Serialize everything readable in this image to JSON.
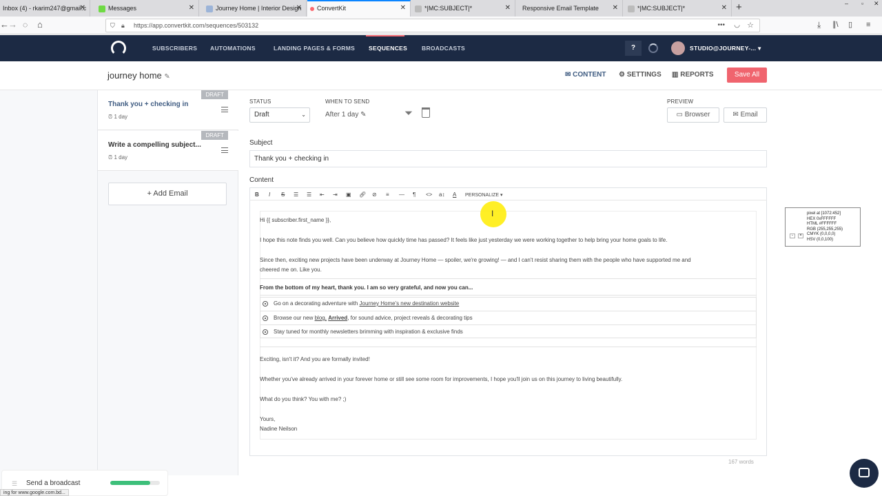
{
  "browser": {
    "tabs": [
      {
        "label": "Inbox (4) - rkarim247@gmail.c",
        "icon": "gmail-icon"
      },
      {
        "label": "Messages",
        "icon": "upwork-icon"
      },
      {
        "label": "Journey Home | Interior Design",
        "icon": "page-icon"
      },
      {
        "label": "ConvertKit",
        "icon": "convertkit-icon",
        "active": true
      },
      {
        "label": "*|MC:SUBJECT|*",
        "icon": "page-icon"
      },
      {
        "label": "Responsive Email Template",
        "icon": "page-icon"
      },
      {
        "label": "*|MC:SUBJECT|*",
        "icon": "page-icon"
      }
    ],
    "url": "https://app.convertkit.com/sequences/503132"
  },
  "app_nav": {
    "items": [
      "SUBSCRIBERS",
      "AUTOMATIONS",
      "LANDING PAGES & FORMS",
      "SEQUENCES",
      "BROADCASTS"
    ],
    "active": "SEQUENCES",
    "help": "?",
    "account": "STUDIO@JOURNEY-..."
  },
  "page": {
    "title": "journey home",
    "tabs": [
      "CONTENT",
      "SETTINGS",
      "REPORTS"
    ],
    "save_all": "Save All"
  },
  "sidebar": {
    "emails": [
      {
        "title": "Thank you + checking in",
        "delay": "1 day",
        "badge": "DRAFT",
        "active": true
      },
      {
        "title": "Write a compelling subject...",
        "delay": "1 day",
        "badge": "DRAFT",
        "active": false
      }
    ],
    "add_email": "Add Email"
  },
  "email": {
    "status_label": "STATUS",
    "status_value": "Draft",
    "when_label": "WHEN TO SEND",
    "when_value": "After 1 day",
    "preview_label": "PREVIEW",
    "preview_browser": "Browser",
    "preview_email": "Email",
    "subject_label": "Subject",
    "subject_value": "Thank you + checking in",
    "content_label": "Content",
    "personalize": "PERSONALIZE",
    "body": {
      "greeting": "Hi {{ subscriber.first_name }},",
      "p1": "I hope this note finds you well. Can you believe how quickly time has passed? It feels like just yesterday we were working together to help bring your home goals to life.",
      "p2a": "Since then, exciting new projects have been underway at Journey Home — spoiler, we're growing! — and I can't resist sharing them with the people who have supported me and",
      "p2b": "cheered me on. Like you.",
      "p3": "From the bottom of my heart, thank you. I am so very grateful, and now you can...",
      "b1_pre": "Go on a decorating adventure with ",
      "b1_link": "Journey Home's new destination website",
      "b2_pre": "Browse our new ",
      "b2_link1": "blog,",
      "b2_link2": "Arrived",
      "b2_post": ", for sound advice, project reveals & decorating tips",
      "b3": "Stay tuned for monthly newsletters brimming with inspiration & exclusive finds",
      "p4": "Exciting, isn't it? And you are formally invited!",
      "p5": "Whether you've already arrived in your forever home or still see some room for improvements, I hope you'll join us on this journey to living beautifully.",
      "p6": "What do you think? You with me? ;)",
      "sign1": "Yours,",
      "sign2": "Nadine Neilson"
    },
    "word_count": "167 words"
  },
  "color_picker": {
    "lines": [
      "pixel at [1072:452]",
      "HEX 0xFFFFFF",
      "HTML #FFFFFF",
      "RGB (255,255,255)",
      "CMYK (0,0,0,0)",
      "HSV (0,0,100)"
    ]
  },
  "broadcast_widget": {
    "label": "Send a broadcast",
    "progress": 0.8
  },
  "status_bar": "ing for www.google.com.bd...",
  "colors": {
    "header": "#1c2a44",
    "save": "#f0646e",
    "active_title": "#3d5a80"
  }
}
